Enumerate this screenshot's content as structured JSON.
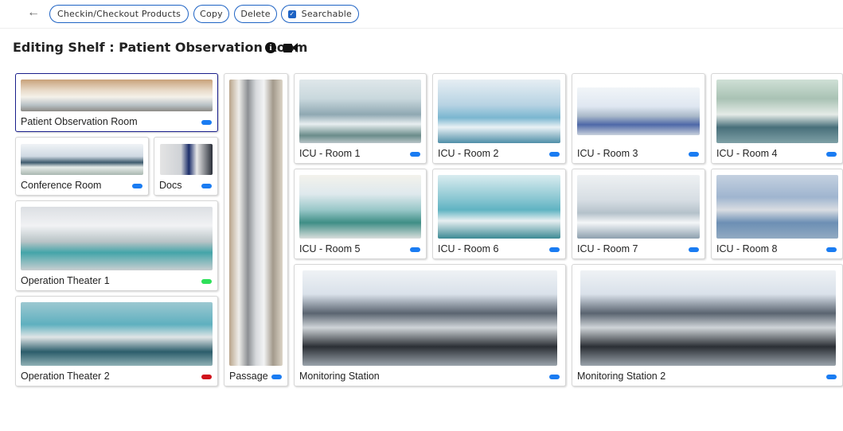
{
  "toolbar": {
    "checkin_label": "Checkin/Checkout Products",
    "copy_label": "Copy",
    "delete_label": "Delete",
    "searchable_label": "Searchable",
    "searchable_checked": true
  },
  "header": {
    "title": "Editing Shelf : Patient Observation Room"
  },
  "colors": {
    "accent": "#1e63c4",
    "status_blue": "#1a7cf2",
    "status_green": "#2ee05a",
    "status_red": "#d0121b"
  },
  "shelf": {
    "observation": {
      "label": "Patient Observation Room",
      "status": "blue"
    },
    "conference": {
      "label": "Conference Room",
      "status": "blue"
    },
    "docs": {
      "label": "Docs",
      "status": "blue"
    },
    "op1": {
      "label": "Operation Theater 1",
      "status": "green"
    },
    "op2": {
      "label": "Operation Theater 2",
      "status": "red"
    },
    "passage": {
      "label": "Passage",
      "status": "blue"
    },
    "icu1": {
      "label": "ICU - Room 1",
      "status": "blue"
    },
    "icu2": {
      "label": "ICU - Room 2",
      "status": "blue"
    },
    "icu3": {
      "label": "ICU - Room 3",
      "status": "blue"
    },
    "icu4": {
      "label": "ICU - Room 4",
      "status": "blue"
    },
    "icu5": {
      "label": "ICU - Room 5",
      "status": "blue"
    },
    "icu6": {
      "label": "ICU - Room 6",
      "status": "blue"
    },
    "icu7": {
      "label": "ICU - Room 7",
      "status": "blue"
    },
    "icu8": {
      "label": "ICU - Room 8",
      "status": "blue"
    },
    "monitor1": {
      "label": "Monitoring Station",
      "status": "blue"
    },
    "monitor2": {
      "label": "Monitoring Station 2",
      "status": "blue"
    }
  }
}
